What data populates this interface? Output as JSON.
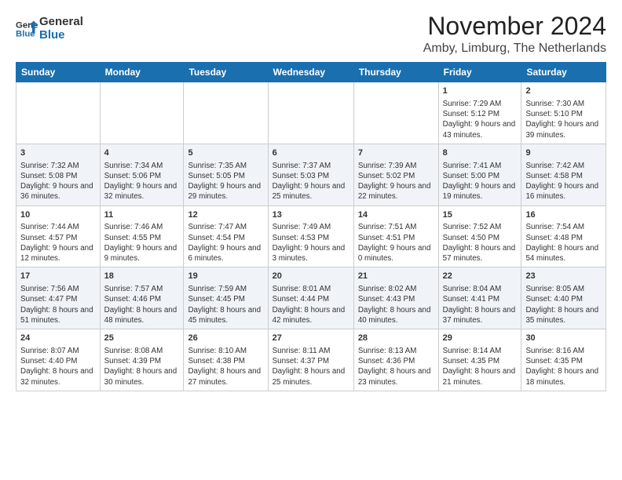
{
  "logo": {
    "line1": "General",
    "line2": "Blue"
  },
  "title": "November 2024",
  "subtitle": "Amby, Limburg, The Netherlands",
  "days_of_week": [
    "Sunday",
    "Monday",
    "Tuesday",
    "Wednesday",
    "Thursday",
    "Friday",
    "Saturday"
  ],
  "weeks": [
    [
      {
        "day": "",
        "info": ""
      },
      {
        "day": "",
        "info": ""
      },
      {
        "day": "",
        "info": ""
      },
      {
        "day": "",
        "info": ""
      },
      {
        "day": "",
        "info": ""
      },
      {
        "day": "1",
        "info": "Sunrise: 7:29 AM\nSunset: 5:12 PM\nDaylight: 9 hours and 43 minutes."
      },
      {
        "day": "2",
        "info": "Sunrise: 7:30 AM\nSunset: 5:10 PM\nDaylight: 9 hours and 39 minutes."
      }
    ],
    [
      {
        "day": "3",
        "info": "Sunrise: 7:32 AM\nSunset: 5:08 PM\nDaylight: 9 hours and 36 minutes."
      },
      {
        "day": "4",
        "info": "Sunrise: 7:34 AM\nSunset: 5:06 PM\nDaylight: 9 hours and 32 minutes."
      },
      {
        "day": "5",
        "info": "Sunrise: 7:35 AM\nSunset: 5:05 PM\nDaylight: 9 hours and 29 minutes."
      },
      {
        "day": "6",
        "info": "Sunrise: 7:37 AM\nSunset: 5:03 PM\nDaylight: 9 hours and 25 minutes."
      },
      {
        "day": "7",
        "info": "Sunrise: 7:39 AM\nSunset: 5:02 PM\nDaylight: 9 hours and 22 minutes."
      },
      {
        "day": "8",
        "info": "Sunrise: 7:41 AM\nSunset: 5:00 PM\nDaylight: 9 hours and 19 minutes."
      },
      {
        "day": "9",
        "info": "Sunrise: 7:42 AM\nSunset: 4:58 PM\nDaylight: 9 hours and 16 minutes."
      }
    ],
    [
      {
        "day": "10",
        "info": "Sunrise: 7:44 AM\nSunset: 4:57 PM\nDaylight: 9 hours and 12 minutes."
      },
      {
        "day": "11",
        "info": "Sunrise: 7:46 AM\nSunset: 4:55 PM\nDaylight: 9 hours and 9 minutes."
      },
      {
        "day": "12",
        "info": "Sunrise: 7:47 AM\nSunset: 4:54 PM\nDaylight: 9 hours and 6 minutes."
      },
      {
        "day": "13",
        "info": "Sunrise: 7:49 AM\nSunset: 4:53 PM\nDaylight: 9 hours and 3 minutes."
      },
      {
        "day": "14",
        "info": "Sunrise: 7:51 AM\nSunset: 4:51 PM\nDaylight: 9 hours and 0 minutes."
      },
      {
        "day": "15",
        "info": "Sunrise: 7:52 AM\nSunset: 4:50 PM\nDaylight: 8 hours and 57 minutes."
      },
      {
        "day": "16",
        "info": "Sunrise: 7:54 AM\nSunset: 4:48 PM\nDaylight: 8 hours and 54 minutes."
      }
    ],
    [
      {
        "day": "17",
        "info": "Sunrise: 7:56 AM\nSunset: 4:47 PM\nDaylight: 8 hours and 51 minutes."
      },
      {
        "day": "18",
        "info": "Sunrise: 7:57 AM\nSunset: 4:46 PM\nDaylight: 8 hours and 48 minutes."
      },
      {
        "day": "19",
        "info": "Sunrise: 7:59 AM\nSunset: 4:45 PM\nDaylight: 8 hours and 45 minutes."
      },
      {
        "day": "20",
        "info": "Sunrise: 8:01 AM\nSunset: 4:44 PM\nDaylight: 8 hours and 42 minutes."
      },
      {
        "day": "21",
        "info": "Sunrise: 8:02 AM\nSunset: 4:43 PM\nDaylight: 8 hours and 40 minutes."
      },
      {
        "day": "22",
        "info": "Sunrise: 8:04 AM\nSunset: 4:41 PM\nDaylight: 8 hours and 37 minutes."
      },
      {
        "day": "23",
        "info": "Sunrise: 8:05 AM\nSunset: 4:40 PM\nDaylight: 8 hours and 35 minutes."
      }
    ],
    [
      {
        "day": "24",
        "info": "Sunrise: 8:07 AM\nSunset: 4:40 PM\nDaylight: 8 hours and 32 minutes."
      },
      {
        "day": "25",
        "info": "Sunrise: 8:08 AM\nSunset: 4:39 PM\nDaylight: 8 hours and 30 minutes."
      },
      {
        "day": "26",
        "info": "Sunrise: 8:10 AM\nSunset: 4:38 PM\nDaylight: 8 hours and 27 minutes."
      },
      {
        "day": "27",
        "info": "Sunrise: 8:11 AM\nSunset: 4:37 PM\nDaylight: 8 hours and 25 minutes."
      },
      {
        "day": "28",
        "info": "Sunrise: 8:13 AM\nSunset: 4:36 PM\nDaylight: 8 hours and 23 minutes."
      },
      {
        "day": "29",
        "info": "Sunrise: 8:14 AM\nSunset: 4:35 PM\nDaylight: 8 hours and 21 minutes."
      },
      {
        "day": "30",
        "info": "Sunrise: 8:16 AM\nSunset: 4:35 PM\nDaylight: 8 hours and 18 minutes."
      }
    ]
  ]
}
